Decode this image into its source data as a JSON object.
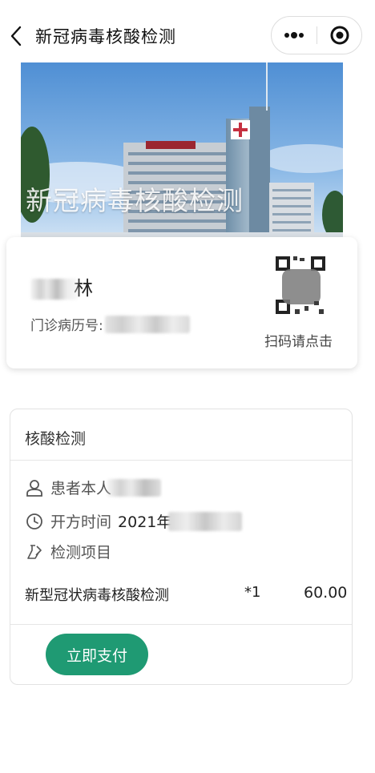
{
  "header": {
    "title": "新冠病毒核酸检测",
    "back_icon": "chevron-left-icon",
    "more_icon": "more-dots-icon",
    "close_icon": "target-close-icon"
  },
  "banner": {
    "title": "新冠病毒核酸检测",
    "sky_color": "#5f9ad6"
  },
  "patient": {
    "name_visible": "林",
    "record_label": "门诊病历号:",
    "qr_hint": "扫码请点击"
  },
  "order": {
    "section_title": "核酸检测",
    "patient_label": "患者本人",
    "prescribe_label": "开方时间",
    "prescribe_value_visible": "2021年",
    "test_items_label": "检测项目",
    "item": {
      "name": "新型冠状病毒核酸检测",
      "qty": "*1",
      "price": "60.00"
    },
    "pay_label": "立即支付"
  },
  "colors": {
    "accent": "#1f9a73",
    "text": "#222222",
    "muted": "#555555"
  }
}
